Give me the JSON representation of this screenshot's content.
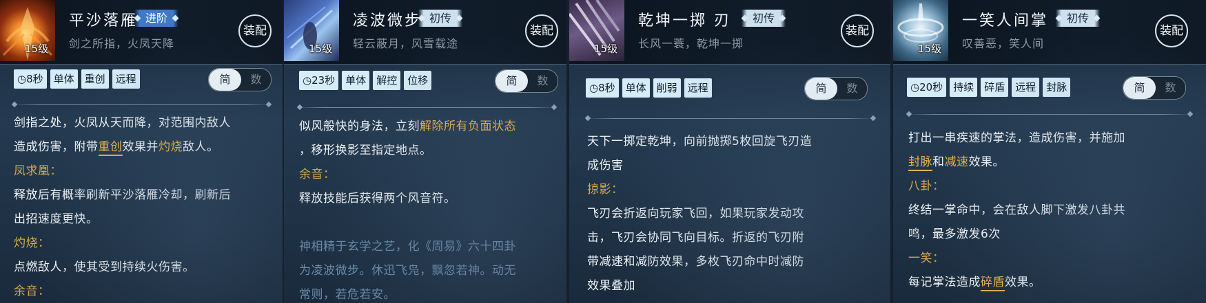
{
  "panels": [
    {
      "name": "平沙落雁",
      "tier": "进阶",
      "subtitle": "剑之所指，火凤天降",
      "level": "15级",
      "equip": "装配",
      "tags": [
        "8秒",
        "单体",
        "重创",
        "远程"
      ],
      "toggle_on": "简",
      "toggle_off": "数",
      "desc": {
        "l1": "剑指之处，火凤从天而降，对范围内敌人",
        "l2a": "造成伤害，附带",
        "l2b": "重创",
        "l2c": "效果并",
        "l2d": "灼烧",
        "l2e": "敌人。",
        "s1": "凤求凰：",
        "l3": "释放后有概率刷新平沙落雁冷却，刷新后",
        "l4": "出招速度更快。",
        "s2": "灼烧：",
        "l5": "点燃敌人，使其受到持续火伤害。",
        "s3": "余音："
      }
    },
    {
      "name": "凌波微步",
      "tier": "初传",
      "subtitle": "轻云蔽月，风雪载途",
      "level": "15级",
      "equip": "装配",
      "tags": [
        "23秒",
        "单体",
        "解控",
        "位移"
      ],
      "toggle_on": "简",
      "toggle_off": "数",
      "desc": {
        "l1a": "似风般快的身法，立刻",
        "l1b": "解除所有负面状态",
        "l2": "，移形换影至指定地点。",
        "s1": "余音：",
        "l3": "释放技能后获得两个风音符。",
        "lore1": "神相精于玄学之艺，化《周易》六十四卦",
        "lore2": "为凌波微步。休迅飞凫，飘忽若神。动无",
        "lore3": "常则，若危若安。"
      }
    },
    {
      "name": "乾坤一掷 刃",
      "tier": "初传",
      "subtitle": "长风一蓑，乾坤一掷",
      "level": "15级",
      "equip": "装配",
      "tags": [
        "8秒",
        "单体",
        "削弱",
        "远程"
      ],
      "toggle_on": "简",
      "toggle_off": "数",
      "desc": {
        "l1": "天下一掷定乾坤，向前抛掷5枚回旋飞刃造",
        "l2": "成伤害",
        "s1": "掠影：",
        "l3": "飞刃会折返向玩家飞回，如果玩家发动攻",
        "l4": "击，飞刃会协同飞向目标。折返的飞刃附",
        "l5": "带减速和减防效果，多枚飞刃命中时减防",
        "l6": "效果叠加"
      }
    },
    {
      "name": "一笑人间掌",
      "tier": "初传",
      "subtitle": "叹善恶，笑人间",
      "level": "15级",
      "equip": "装配",
      "tags": [
        "20秒",
        "持续",
        "碎盾",
        "远程",
        "封脉"
      ],
      "toggle_on": "简",
      "toggle_off": "数",
      "desc": {
        "l1": "打出一串疾速的掌法，造成伤害，并施加",
        "l2a": "封脉",
        "l2b": "和",
        "l2c": "减速",
        "l2d": "效果。",
        "s1": "八卦：",
        "l3": "终结一掌命中，会在敌人脚下激发八卦共",
        "l4": "鸣，最多激发6次",
        "s2": "一笑：",
        "l5a": "每记掌法造成",
        "l5b": "碎盾",
        "l5c": "效果。"
      }
    }
  ]
}
